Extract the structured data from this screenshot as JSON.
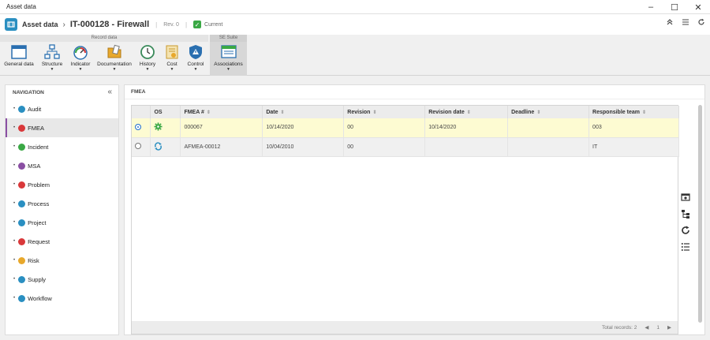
{
  "window": {
    "title": "Asset data",
    "controls": [
      "–",
      "☐",
      "✕"
    ]
  },
  "header": {
    "breadcrumb": "Asset data",
    "record": "IT-000128 - Firewall",
    "revision": "Rev. 0",
    "status": "Current"
  },
  "ribbon": {
    "group_record": "Record data",
    "group_se": "SE Suite",
    "buttons": [
      {
        "label": "General data",
        "icon": "general-data-icon",
        "dropdown": false
      },
      {
        "label": "Structure",
        "icon": "structure-icon",
        "dropdown": true
      },
      {
        "label": "Indicator",
        "icon": "indicator-icon",
        "dropdown": true
      },
      {
        "label": "Documentation",
        "icon": "documentation-icon",
        "dropdown": true
      },
      {
        "label": "History",
        "icon": "history-icon",
        "dropdown": true
      },
      {
        "label": "Cost",
        "icon": "cost-icon",
        "dropdown": true
      },
      {
        "label": "Control",
        "icon": "control-icon",
        "dropdown": true
      },
      {
        "label": "Associations",
        "icon": "associations-icon",
        "dropdown": true
      }
    ]
  },
  "navigation": {
    "title": "NAVIGATION",
    "items": [
      {
        "label": "Audit",
        "color": "#2a8fc1"
      },
      {
        "label": "FMEA",
        "color": "#d9383a"
      },
      {
        "label": "Incident",
        "color": "#3aa845"
      },
      {
        "label": "MSA",
        "color": "#8a4fa3"
      },
      {
        "label": "Problem",
        "color": "#d9383a"
      },
      {
        "label": "Process",
        "color": "#2a8fc1"
      },
      {
        "label": "Project",
        "color": "#2a8fc1"
      },
      {
        "label": "Request",
        "color": "#d9383a"
      },
      {
        "label": "Risk",
        "color": "#e8a82b"
      },
      {
        "label": "Supply",
        "color": "#2a8fc1"
      },
      {
        "label": "Workflow",
        "color": "#2a8fc1"
      }
    ],
    "active": "FMEA"
  },
  "panel": {
    "title": "FMEA",
    "columns": [
      "OS",
      "FMEA #",
      "Date",
      "Revision",
      "Revision date",
      "Deadline",
      "Responsible team"
    ],
    "rows": [
      {
        "fmea": "000067",
        "date": "10/14/2020",
        "revision": "00",
        "revision_date": "10/14/2020",
        "deadline": "",
        "team": "003",
        "status_icon": "green-gear-icon"
      },
      {
        "fmea": "AFMEA-00012",
        "date": "10/04/2010",
        "revision": "00",
        "revision_date": "",
        "deadline": "",
        "team": "IT",
        "status_icon": "blue-refresh-icon"
      }
    ],
    "footer": {
      "total": "Total records: 2",
      "page": "1"
    }
  }
}
